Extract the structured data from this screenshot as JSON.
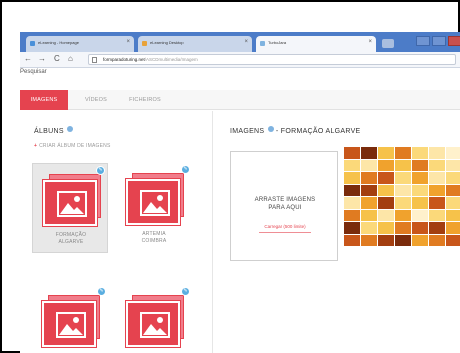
{
  "browser": {
    "tabs": [
      {
        "label": "eLearning - Homepage",
        "favicon_color": "#4a90d9"
      },
      {
        "label": "eLearning Desktop",
        "favicon_color": "#e8a23a"
      },
      {
        "label": "TurboJara",
        "favicon_color": "#7fb3e0"
      }
    ],
    "tab_close_glyph": "×",
    "nav": {
      "back": "←",
      "forward": "→",
      "reload": "C",
      "home": "⌂"
    },
    "url_host": "formparadoturing.net",
    "url_path": "/ASCDmultimedia/Imagem",
    "partial_label": "Pesquisar"
  },
  "app": {
    "tabs": [
      "IMAGENS",
      "VÍDEOS",
      "FICHEIROS"
    ],
    "active_tab": 0
  },
  "sidebar": {
    "title": "ÁLBUNS",
    "create_link": "CRIAR ÁLBUM DE IMAGENS",
    "create_plus": "+",
    "albums": [
      {
        "line1": "FORMAÇÃO",
        "line2": "ALGARVE",
        "selected": true
      },
      {
        "line1": "ARTEMIA",
        "line2": "COIMBRA",
        "selected": false
      },
      {
        "line1": "",
        "line2": "",
        "selected": false
      },
      {
        "line1": "",
        "line2": "",
        "selected": false
      }
    ]
  },
  "main": {
    "title_prefix": "IMAGENS",
    "title_separator": "-",
    "title_album": "FORMAÇÃO ALGARVE",
    "dropzone_line1": "ARRASTE IMAGENS",
    "dropzone_line2": "PARA AQUI",
    "dropzone_hint": "Carregar (500 limite)"
  },
  "colors": {
    "accent": "#e5434f",
    "info": "#7fb3e0",
    "thumb_palette": [
      "#7a2b0c",
      "#a33e10",
      "#c8561a",
      "#e07b21",
      "#f0a22d",
      "#f6c24a",
      "#fbd97a",
      "#fde6a8",
      "#fff1cc"
    ]
  },
  "thumbnail_grid": [
    [
      2,
      0,
      5,
      3,
      6,
      7,
      8
    ],
    [
      6,
      7,
      4,
      5,
      3,
      6,
      7
    ],
    [
      5,
      3,
      2,
      6,
      4,
      7,
      6
    ],
    [
      0,
      1,
      5,
      7,
      6,
      4,
      3
    ],
    [
      7,
      4,
      1,
      6,
      5,
      2,
      6
    ],
    [
      3,
      5,
      7,
      4,
      8,
      6,
      5
    ],
    [
      0,
      6,
      5,
      3,
      2,
      1,
      4
    ],
    [
      2,
      3,
      1,
      0,
      4,
      3,
      2
    ]
  ]
}
